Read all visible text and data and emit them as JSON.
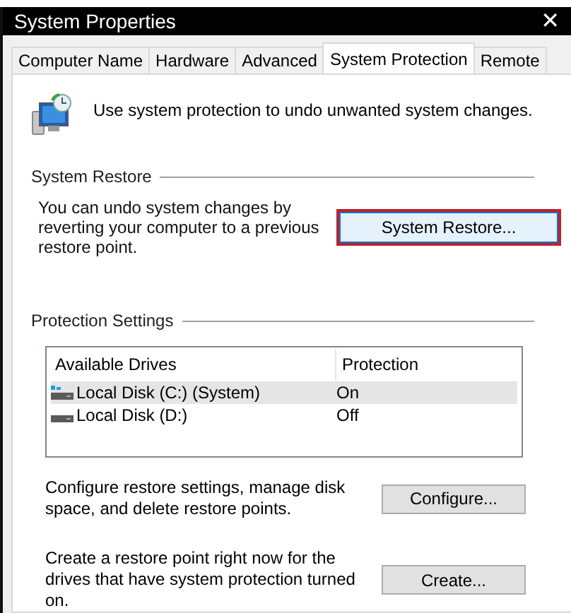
{
  "window": {
    "title": "System Properties",
    "close": "✕"
  },
  "tabs": [
    {
      "label": "Computer Name",
      "selected": false
    },
    {
      "label": "Hardware",
      "selected": false
    },
    {
      "label": "Advanced",
      "selected": false
    },
    {
      "label": "System Protection",
      "selected": true
    },
    {
      "label": "Remote",
      "selected": false
    }
  ],
  "intro": "Use system protection to undo unwanted system changes.",
  "system_restore": {
    "heading": "System Restore",
    "description": "You can undo system changes by reverting your computer to a previous restore point.",
    "button": {
      "label": "System Restore...",
      "highlighted": true
    }
  },
  "protection_settings": {
    "heading": "Protection Settings",
    "columns": [
      "Available Drives",
      "Protection"
    ],
    "drives": [
      {
        "name": "Local Disk (C:) (System)",
        "protection": "On",
        "system": true,
        "selected": true
      },
      {
        "name": "Local Disk (D:)",
        "protection": "Off",
        "system": false,
        "selected": false
      }
    ],
    "actions": [
      {
        "description": "Configure restore settings, manage disk space, and delete restore points.",
        "button": "Configure..."
      },
      {
        "description": "Create a restore point right now for the drives that have system protection turned on.",
        "button": "Create..."
      }
    ]
  }
}
